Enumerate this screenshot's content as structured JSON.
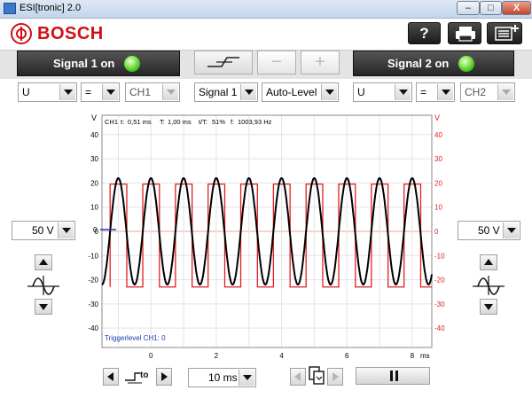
{
  "window": {
    "title": "ESI[tronic] 2.0",
    "min": "–",
    "max": "□",
    "close": "X"
  },
  "header": {
    "brand": "BOSCH",
    "help": "?"
  },
  "signal1": {
    "label": "Signal 1 on",
    "led_color": "#4cd12a"
  },
  "signal2": {
    "label": "Signal 2 on",
    "led_color": "#4cd12a"
  },
  "trigger_controls": {
    "minus": "−",
    "plus": "+"
  },
  "dropdowns": {
    "ch1_quantity": "U",
    "ch1_coupling": "=",
    "ch1_source": "CH1",
    "trigger_source": "Signal 1",
    "trigger_mode": "Auto-Level",
    "ch2_quantity": "U",
    "ch2_coupling": "=",
    "ch2_source": "CH2"
  },
  "scope": {
    "info": {
      "ch": "CH1",
      "t_label": "t:",
      "t_value": "0,51 ms",
      "T_label": "T:",
      "T_value": "1,00 ms",
      "duty_label": "t/T:",
      "duty_value": "51%",
      "f_label": "f:",
      "f_value": "1003,93 Hz"
    },
    "unit_left": "V",
    "unit_right": "V",
    "x_unit": "ms",
    "trigger_text": "Triggerlevel CH1: 0",
    "trigger_marker": "0",
    "y_ticks": [
      "40",
      "30",
      "20",
      "10",
      "0",
      "-10",
      "-20",
      "-30",
      "-40"
    ],
    "x_ticks": [
      "0",
      "2",
      "4",
      "6",
      "8"
    ]
  },
  "chart_data": {
    "type": "line",
    "xlabel": "ms",
    "ylabel": "V",
    "xlim": [
      -1.5,
      8.6
    ],
    "ylim": [
      -48,
      48
    ],
    "grid": true,
    "series": [
      {
        "color": "#000000",
        "kind": "sine",
        "amplitude": 22,
        "offset": 0,
        "period_ms": 1.0,
        "phase_x": -0.25
      },
      {
        "color": "#e02020",
        "kind": "square",
        "high": 19.5,
        "low": -23,
        "period_ms": 1.0,
        "duty": 0.51,
        "rise_x": -0.25
      }
    ]
  },
  "left_panel": {
    "voltage_range": "50 V"
  },
  "right_panel": {
    "voltage_range": "50 V"
  },
  "bottom": {
    "trigger_symbol": "to",
    "timebase": "10 ms"
  },
  "colors": {
    "brand_red": "#d10f16",
    "ch1_trace": "#000000",
    "ch2_trace": "#e02020",
    "trigger_text": "#1f3fb2"
  }
}
